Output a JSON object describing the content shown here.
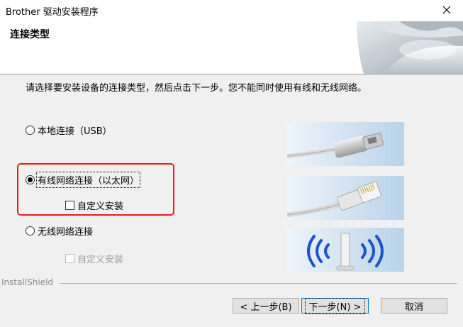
{
  "window": {
    "title": "Brother 驱动安装程序",
    "close_icon": "close-icon"
  },
  "header": {
    "page_title": "连接类型"
  },
  "body": {
    "instruction": "请选择要安装设备的连接类型，然后点击下一步。您不能同时使用有线和无线网络。",
    "options": {
      "usb_label": "本地连接（USB）",
      "wired_label": "有线网络连接（以太网）",
      "wired_custom_label": "自定义安装",
      "wireless_label": "无线网络连接",
      "wireless_custom_label": "自定义安装"
    },
    "selected": "wired",
    "images": {
      "usb": "usb-cable-illustration",
      "ethernet": "ethernet-cable-illustration",
      "wireless": "wireless-router-illustration"
    }
  },
  "footer": {
    "brand": "InstallShield",
    "back_label": "< 上一步(B)",
    "next_label": "下一步(N) >",
    "cancel_label": "取消"
  },
  "colors": {
    "highlight": "#e02020",
    "panel_bg": "#c8dff2",
    "wifi_blue": "#1a56c8"
  }
}
